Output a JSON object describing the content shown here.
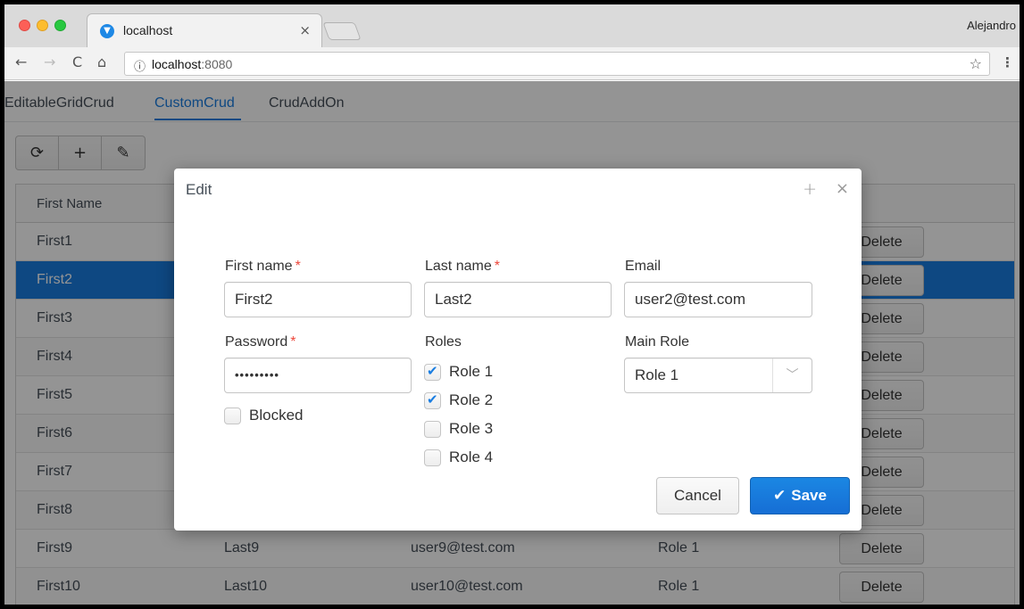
{
  "browser": {
    "tab_title": "localhost",
    "tab_close": "×",
    "profile_name": "Alejandro",
    "url_host": "localhost",
    "url_port": ":8080",
    "icons": {
      "back": "←",
      "forward": "→",
      "reload": "C",
      "home": "⌂",
      "info": "ⓘ",
      "star": "☆",
      "menu": "⋮",
      "favicon": "▼"
    }
  },
  "app": {
    "tabs": [
      {
        "label": "EditableGridCrud"
      },
      {
        "label": "CustomCrud"
      },
      {
        "label": "CrudAddOn"
      }
    ],
    "toolbar": {
      "refresh_icon": "⟳",
      "add_icon": "+",
      "edit_icon": "✎"
    },
    "grid": {
      "header": "First Name",
      "delete_label": "Delete",
      "rows": [
        {
          "first": "First1"
        },
        {
          "first": "First2"
        },
        {
          "first": "First3"
        },
        {
          "first": "First4"
        },
        {
          "first": "First5"
        },
        {
          "first": "First6"
        },
        {
          "first": "First7"
        },
        {
          "first": "First8"
        },
        {
          "first": "First9",
          "last": "Last9",
          "email": "user9@test.com",
          "role": "Role 1"
        },
        {
          "first": "First10",
          "last": "Last10",
          "email": "user10@test.com",
          "role": "Role 1"
        }
      ],
      "delete_partial": "Delete"
    }
  },
  "dialog": {
    "title": "Edit",
    "maximize_icon": "+",
    "close_icon": "×",
    "required_marker": "*",
    "first_name": {
      "label": "First name",
      "value": "First2"
    },
    "last_name": {
      "label": "Last name",
      "value": "Last2"
    },
    "email": {
      "label": "Email",
      "value": "user2@test.com"
    },
    "password": {
      "label": "Password",
      "value": "•••••••••"
    },
    "blocked": {
      "label": "Blocked",
      "checked": false
    },
    "roles": {
      "label": "Roles",
      "options": [
        {
          "label": "Role 1",
          "checked": true
        },
        {
          "label": "Role 2",
          "checked": true
        },
        {
          "label": "Role 3",
          "checked": false
        },
        {
          "label": "Role 4",
          "checked": false
        }
      ]
    },
    "main_role": {
      "label": "Main Role",
      "value": "Role 1",
      "arrow_icon": "﹀"
    },
    "cancel_label": "Cancel",
    "save_label": "Save",
    "save_icon": "✔"
  },
  "colors": {
    "accent": "#197de1",
    "required": "#ed473b"
  }
}
